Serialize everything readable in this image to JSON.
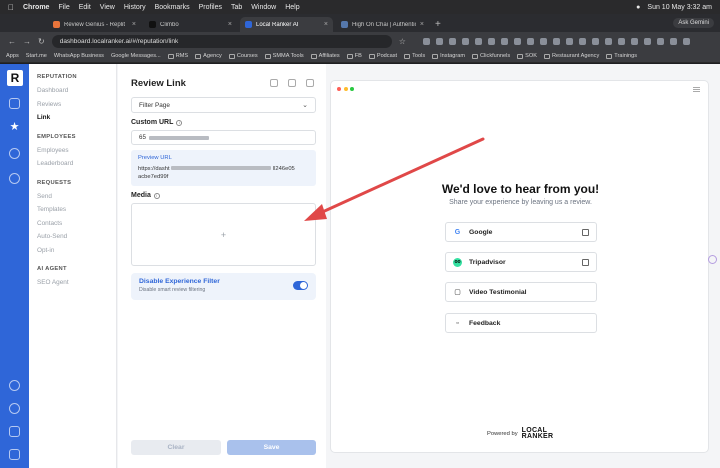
{
  "menubar": {
    "app": "Chrome",
    "items": [
      "File",
      "Edit",
      "View",
      "History",
      "Bookmarks",
      "Profiles",
      "Tab",
      "Window",
      "Help"
    ],
    "clock": "Sun 10 May  3:32 am"
  },
  "tabs": [
    {
      "title": "Review Genius - Replit"
    },
    {
      "title": "Climbo"
    },
    {
      "title": "Local Ranker AI"
    },
    {
      "title": "High On Chai | Authentic Indi"
    }
  ],
  "gemini_label": "Ask Gemini",
  "address": {
    "url": "dashboard.localranker.ai/#/reputation/link"
  },
  "bookmarks": [
    "Apps",
    "Start.me",
    "WhatsApp Business",
    "Google Messages...",
    "RMS",
    "Agency",
    "Courses",
    "SMMA Tools",
    "Affiliates",
    "FB",
    "Podcast",
    "Tools",
    "Instagram",
    "Clickfunnels",
    "SOK",
    "Restaurant Agency",
    "Trainings"
  ],
  "rail": {
    "logo": "R"
  },
  "nav": {
    "sections": [
      {
        "title": "REPUTATION",
        "items": [
          "Dashboard",
          "Reviews",
          "Link"
        ]
      },
      {
        "title": "EMPLOYEES",
        "items": [
          "Employees",
          "Leaderboard"
        ]
      },
      {
        "title": "REQUESTS",
        "items": [
          "Send",
          "Templates",
          "Contacts",
          "Auto-Send",
          "Opt-in"
        ]
      },
      {
        "title": "AI AGENT",
        "items": [
          "SEO Agent"
        ]
      }
    ],
    "active": "Link"
  },
  "panel": {
    "title": "Review Link",
    "filter_select": "Filter Page",
    "custom_url_label": "Custom URL",
    "custom_url_prefix": "65",
    "preview_label": "Preview URL",
    "preview_line1_start": "https://dasht",
    "preview_line1_end": "ll246e05",
    "preview_line2": "acbe7ed99f",
    "media_label": "Media",
    "media_plus": "+",
    "toggle_title": "Disable Experience Filter",
    "toggle_sub": "Disable smart review filtering",
    "toggle_on": true,
    "clear": "Clear",
    "save": "Save"
  },
  "preview": {
    "headline": "We'd love to hear from you!",
    "subline": "Share your experience by leaving us a review.",
    "options": [
      {
        "label": "Google",
        "icon": "google-icon",
        "external": true
      },
      {
        "label": "Tripadvisor",
        "icon": "tripadvisor-icon",
        "external": true
      },
      {
        "label": "Video Testimonial",
        "icon": "video-icon",
        "external": false
      },
      {
        "label": "Feedback",
        "icon": "feedback-icon",
        "external": false
      }
    ],
    "powered_by": "Powered by",
    "brand_line1": "LOCAL",
    "brand_line2": "RANKER"
  },
  "colors": {
    "accent": "#2f66d8",
    "arrow": "#e04848"
  }
}
